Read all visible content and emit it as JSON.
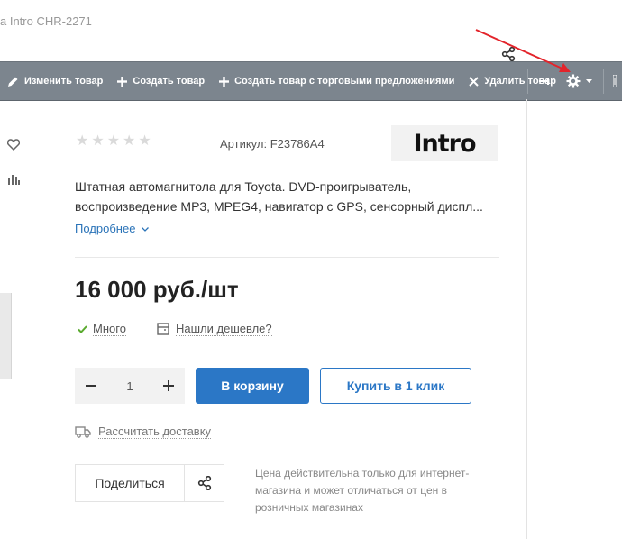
{
  "breadcrumb": "a Intro CHR-2271",
  "toolbar": {
    "edit_label": "Изменить товар",
    "create_label": "Создать товар",
    "create_offers_label": "Создать товар с торговыми предложениями",
    "delete_label": "Удалить товар"
  },
  "product": {
    "rating_stars": 5,
    "rating_value": 0,
    "sku": "Артикул: F23786A4",
    "brand": "Intro",
    "description_lines": [
      "Штатная автомагнитола для Toyota. DVD-проигрыватель,",
      "воспроизведение MP3, MPEG4, навигатор с GPS, сенсорный диспл..."
    ],
    "more_label": "Подробнее",
    "price": "16 000 руб./шт",
    "stock_label": "Много",
    "cheaper_label": "Нашли дешевле?",
    "quantity": "1",
    "cart_label": "В корзину",
    "one_click_label": "Купить в 1 клик",
    "delivery_label": "Рассчитать доставку",
    "share_label": "Поделиться",
    "note": "Цена действительна только для интернет-магазина и может отличаться от цен в розничных магазинах"
  },
  "colors": {
    "toolbar_bg": "#7c858e",
    "accent": "#2b77c6",
    "stock_check": "#5aaa2f",
    "arrow": "#e3242b"
  }
}
